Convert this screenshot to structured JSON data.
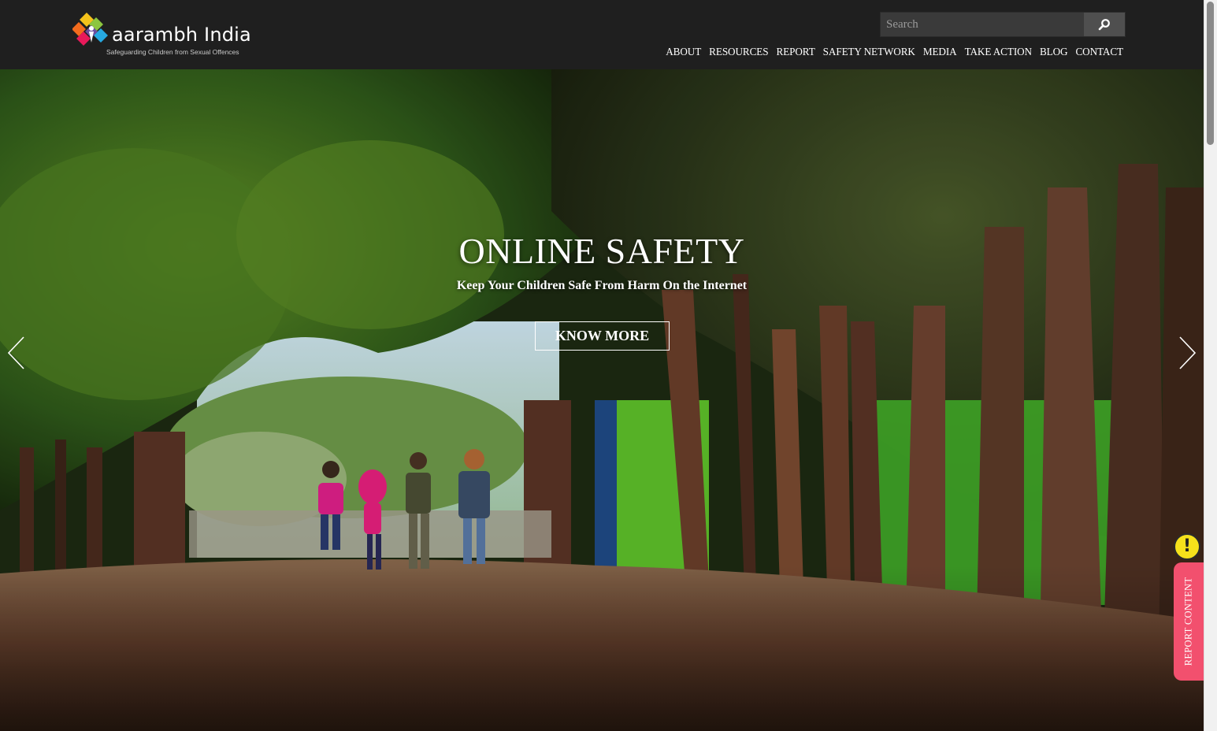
{
  "header": {
    "logo_name": "aarambh India",
    "logo_tagline": "Safeguarding Children from Sexual Offences",
    "search_placeholder": "Search",
    "nav": [
      "ABOUT",
      "RESOURCES",
      "REPORT",
      "SAFETY NETWORK",
      "MEDIA",
      "TAKE ACTION",
      "BLOG",
      "CONTACT"
    ]
  },
  "hero": {
    "title": "ONLINE SAFETY",
    "subtitle": "Keep Your Children Safe From Harm On the Internet",
    "button": "KNOW MORE"
  },
  "report_widget": {
    "label": "REPORT CONTENT",
    "alert_symbol": "!"
  },
  "colors": {
    "header_bg": "#1f1f1f",
    "report_tab": "#f2506e",
    "alert_badge": "#f6e11b"
  },
  "icons": [
    "search-icon",
    "chevron-left-icon",
    "chevron-right-icon",
    "alert-icon",
    "logo-mark-icon"
  ]
}
